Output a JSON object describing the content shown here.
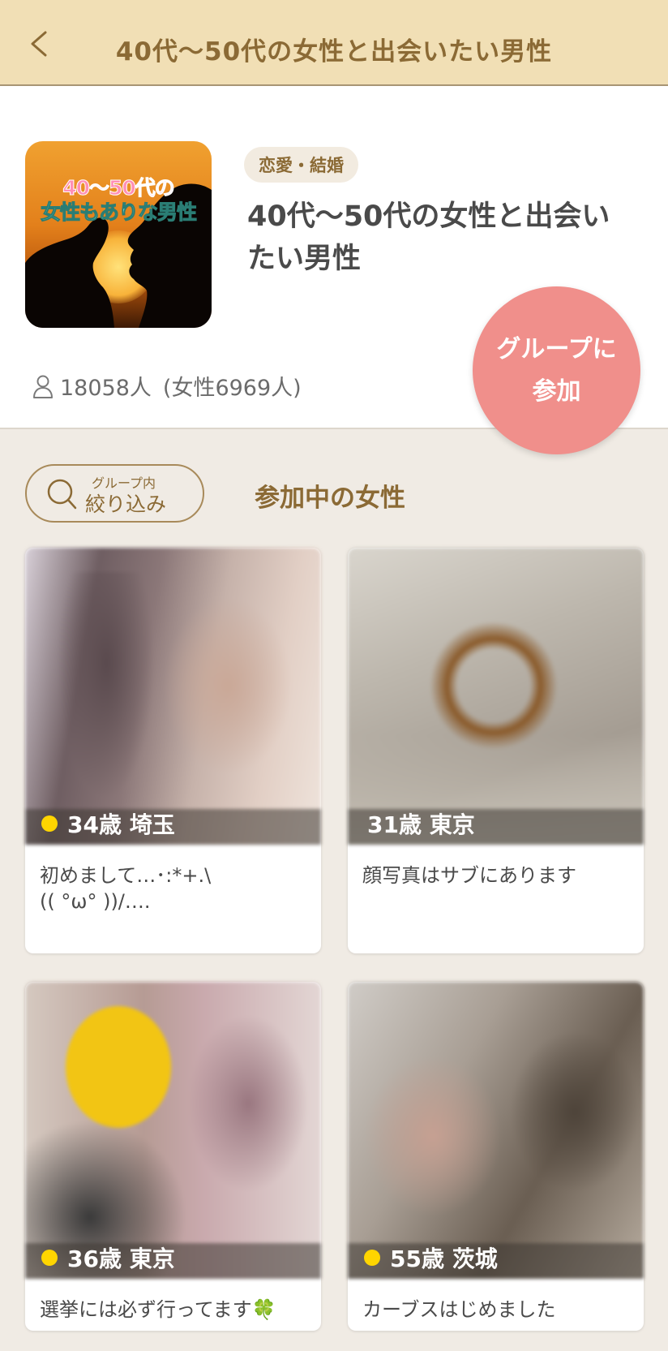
{
  "header": {
    "back_icon": "chevron-left-icon",
    "title": "40代〜50代の女性と出会いたい男性"
  },
  "group": {
    "thumbnail_text_line1": "40〜50代の",
    "thumbnail_text_line2": "女性もありな男性",
    "category": "恋愛・結婚",
    "title": "40代〜50代の女性と出会いたい男性",
    "members_total": "18058人",
    "members_female": "(女性6969人)",
    "member_icon": "person-icon"
  },
  "join_button": {
    "line1": "グループに",
    "line2": "参加"
  },
  "filter": {
    "small_label": "グループ内",
    "main_label": "絞り込み",
    "icon": "search-icon"
  },
  "section_title": "参加中の女性",
  "members_list": [
    {
      "online": true,
      "age_area": "34歳 埼玉",
      "message": "初めまして…･:*+.\\\n(( °ω° ))/…."
    },
    {
      "online": false,
      "age_area": "31歳 東京",
      "message": "顔写真はサブにあります"
    },
    {
      "online": true,
      "age_area": "36歳 東京",
      "message": "選挙には必ず行ってます🍀"
    },
    {
      "online": true,
      "age_area": "55歳 茨城",
      "message": "カーブスはじめました"
    }
  ],
  "colors": {
    "header_bg": "#f1dfb5",
    "accent_brown": "#8b6a35",
    "join_pink": "#f08f8b",
    "page_bg": "#f0ebe4",
    "online_dot": "#ffd500"
  }
}
